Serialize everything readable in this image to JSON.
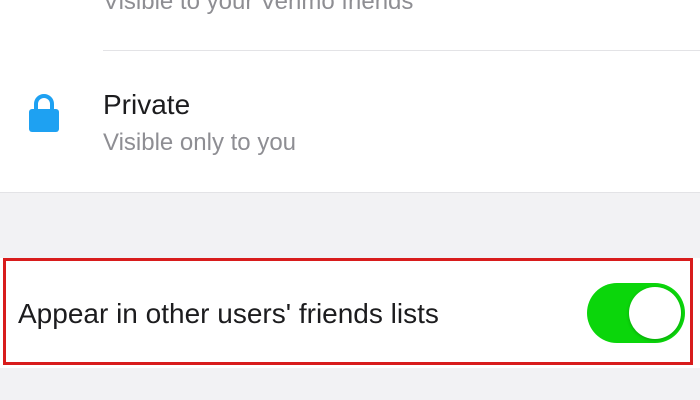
{
  "options": {
    "partial_subtitle": "Visible to your Venmo friends",
    "private": {
      "title": "Private",
      "subtitle": "Visible only to you",
      "icon": "lock-icon",
      "icon_color": "#1ea1f2"
    }
  },
  "friends_list_toggle": {
    "label": "Appear in other users' friends lists",
    "enabled": true,
    "on_color": "#0bd60b"
  },
  "highlight_color": "#d81c1c"
}
